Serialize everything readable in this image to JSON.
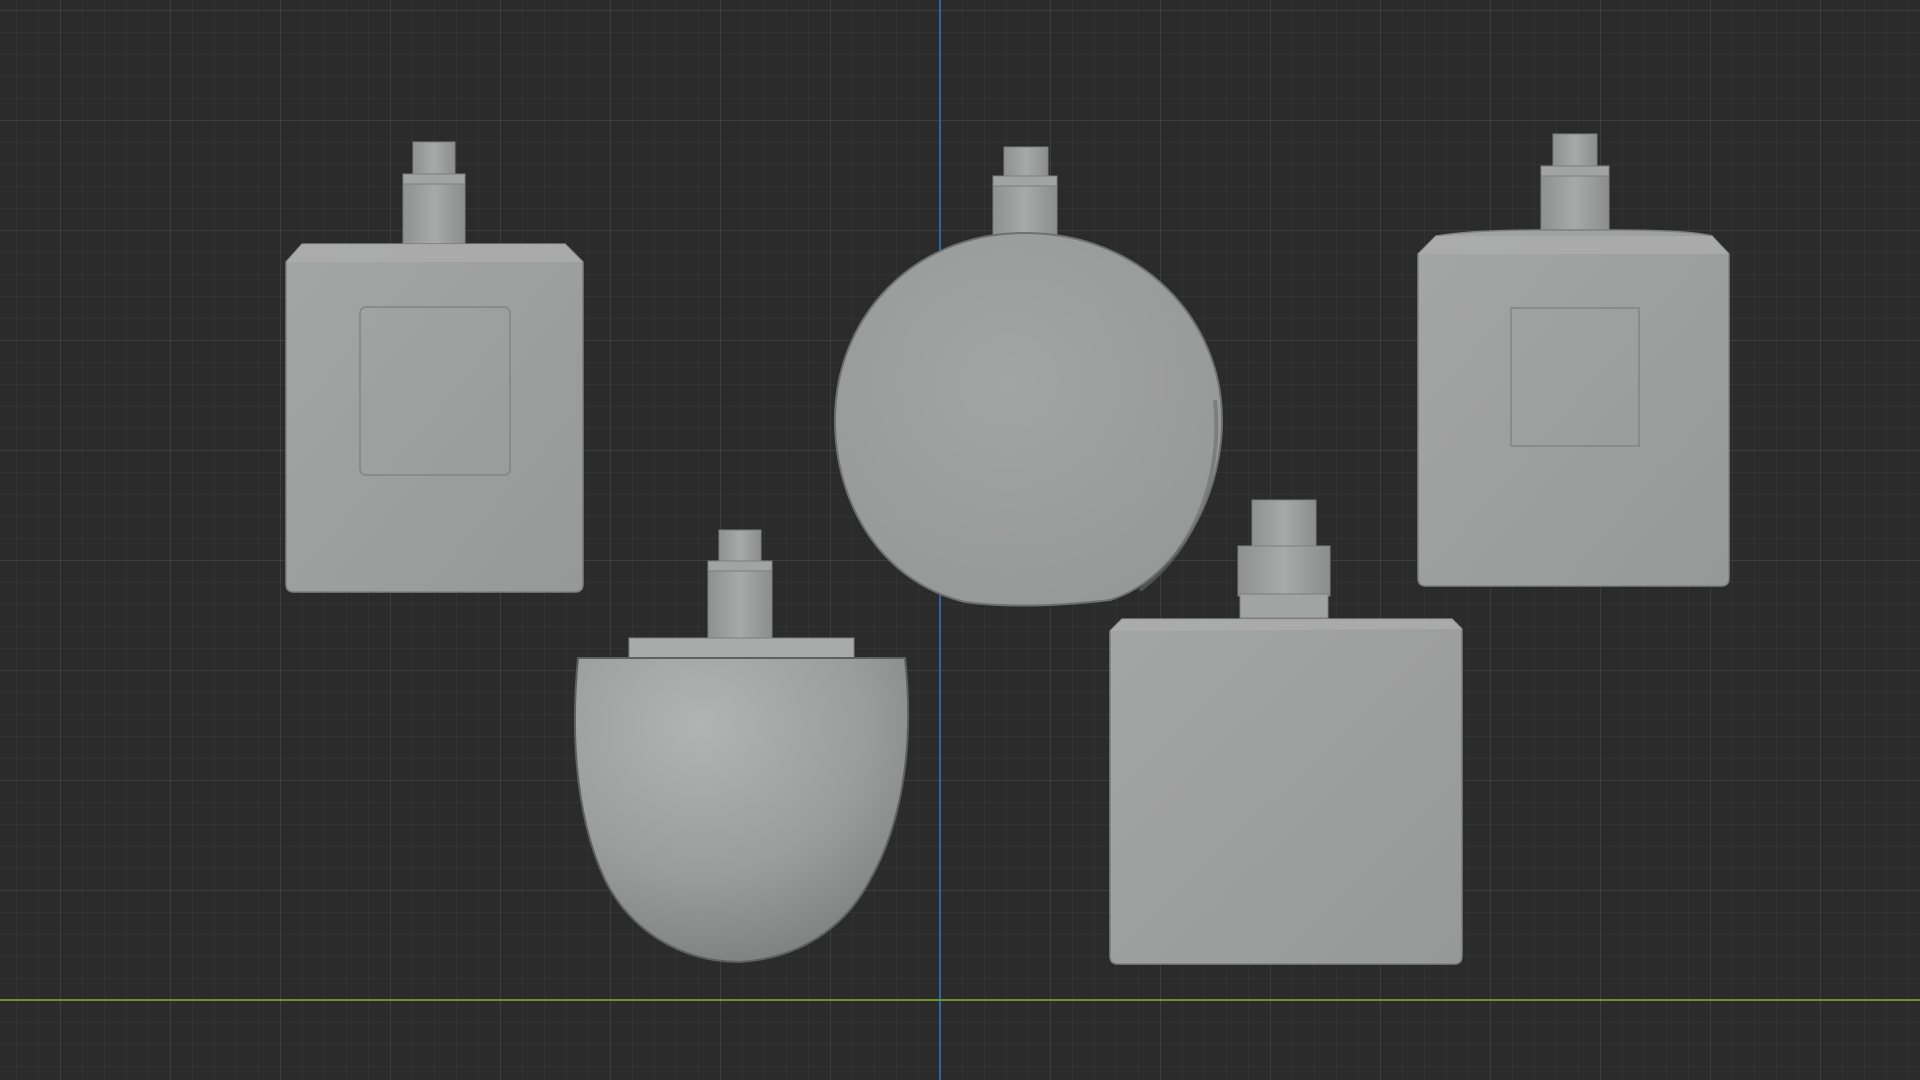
{
  "viewport": {
    "background_color": "#2b2b2b",
    "grid_color": "#3a3a3a",
    "x_axis_color": "#7a9b28",
    "z_axis_color": "#2e6fb5",
    "object_color": "#9fa0a0"
  },
  "objects": [
    {
      "name": "bottle-rectangular-left",
      "shape": "rectangular-with-label"
    },
    {
      "name": "bottle-round",
      "shape": "round-disc"
    },
    {
      "name": "bottle-rectangular-right",
      "shape": "rectangular-with-label"
    },
    {
      "name": "bottle-egg",
      "shape": "egg"
    },
    {
      "name": "bottle-square",
      "shape": "square"
    }
  ]
}
